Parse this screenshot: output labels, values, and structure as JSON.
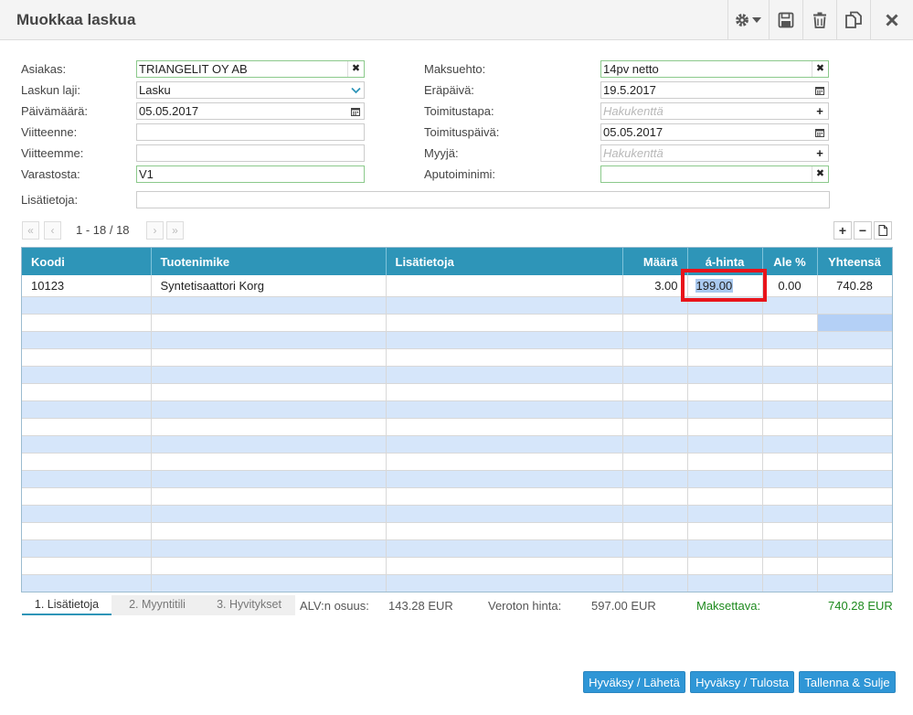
{
  "window": {
    "title": "Muokkaa laskua"
  },
  "header_icons": [
    "gear-icon",
    "save-icon",
    "trash-icon",
    "copy-icon",
    "close-icon"
  ],
  "form": {
    "customer": {
      "label": "Asiakas:",
      "value": "TRIANGELIT OY AB"
    },
    "invoice_type": {
      "label": "Laskun laji:",
      "value": "Lasku"
    },
    "date": {
      "label": "Päivämäärä:",
      "value": "05.05.2017"
    },
    "your_ref": {
      "label": "Viitteenne:",
      "value": ""
    },
    "our_ref": {
      "label": "Viitteemme:",
      "value": ""
    },
    "warehouse": {
      "label": "Varastosta:",
      "value": "V1"
    },
    "payment_term": {
      "label": "Maksuehto:",
      "value": "14pv netto"
    },
    "due_date": {
      "label": "Eräpäivä:",
      "value": "19.5.2017"
    },
    "delivery_method": {
      "label": "Toimitustapa:",
      "placeholder": "Hakukenttä"
    },
    "delivery_date": {
      "label": "Toimituspäivä:",
      "value": "05.05.2017"
    },
    "seller": {
      "label": "Myyjä:",
      "placeholder": "Hakukenttä"
    },
    "aux_name": {
      "label": "Aputoiminimi:",
      "value": ""
    },
    "extra_info": {
      "label": "Lisätietoja:",
      "value": ""
    }
  },
  "pager": {
    "info": "1 - 18 / 18"
  },
  "table": {
    "headers": {
      "code": "Koodi",
      "product": "Tuotenimike",
      "info": "Lisätietoja",
      "qty": "Määrä",
      "unit_price": "á-hinta",
      "discount": "Ale %",
      "total": "Yhteensä"
    },
    "rows": [
      {
        "code": "10123",
        "product": "Syntetisaattori Korg",
        "info": "",
        "qty": "3.00",
        "unit_price": "199.00",
        "discount": "0.00",
        "total": "740.28"
      }
    ],
    "empty_rows": 17
  },
  "tabs": [
    "1. Lisätietoja",
    "2. Myyntitili",
    "3. Hyvitykset"
  ],
  "summary": {
    "vat_label": "ALV:n osuus:",
    "vat_value": "143.28 EUR",
    "net_label": "Veroton hinta:",
    "net_value": "597.00 EUR",
    "payable_label": "Maksettava:",
    "payable_value": "740.28 EUR"
  },
  "buttons": {
    "approve_send": "Hyväksy / Lähetä",
    "approve_print": "Hyväksy / Tulosta",
    "save_close": "Tallenna & Sulje"
  }
}
